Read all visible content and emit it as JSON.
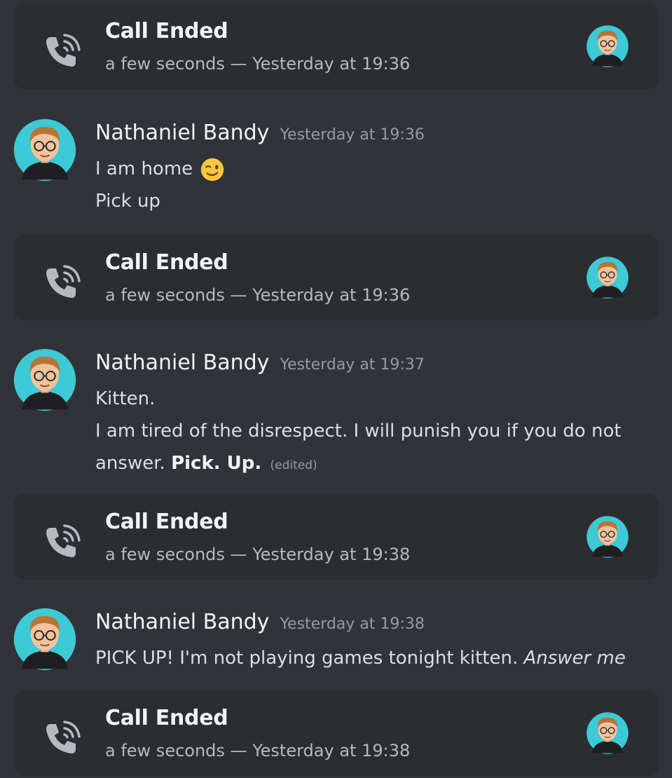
{
  "calls": [
    {
      "title": "Call Ended",
      "duration": "a few seconds",
      "separator": "—",
      "timestamp": "Yesterday at 19:36"
    },
    {
      "title": "Call Ended",
      "duration": "a few seconds",
      "separator": "—",
      "timestamp": "Yesterday at 19:36"
    },
    {
      "title": "Call Ended",
      "duration": "a few seconds",
      "separator": "—",
      "timestamp": "Yesterday at 19:38"
    },
    {
      "title": "Call Ended",
      "duration": "a few seconds",
      "separator": "—",
      "timestamp": "Yesterday at 19:38"
    }
  ],
  "messages": [
    {
      "author": "Nathaniel Bandy",
      "timestamp": "Yesterday at 19:36",
      "line1": "I am home",
      "line1_emoji": "winking-face-emoji",
      "line2": "Pick up"
    },
    {
      "author": "Nathaniel Bandy",
      "timestamp": "Yesterday at 19:37",
      "line1": "Kitten.",
      "line2": "I am tired of the disrespect. I will punish you if you do not",
      "line3_plain": "answer.",
      "line3_bold": "Pick. Up.",
      "edited": "(edited)"
    },
    {
      "author": "Nathaniel Bandy",
      "timestamp": "Yesterday at 19:38",
      "line1_plain": "PICK UP! I'm not playing games tonight kitten.",
      "line1_italic": "Answer me"
    }
  ],
  "colors": {
    "background": "#313338",
    "call_card": "#2b2d31",
    "avatar_bg": "#3ec9d6",
    "text": "#dbdee1",
    "muted": "#949ba4"
  },
  "icons": {
    "call": "phone-call-icon",
    "avatar": "user-avatar"
  }
}
